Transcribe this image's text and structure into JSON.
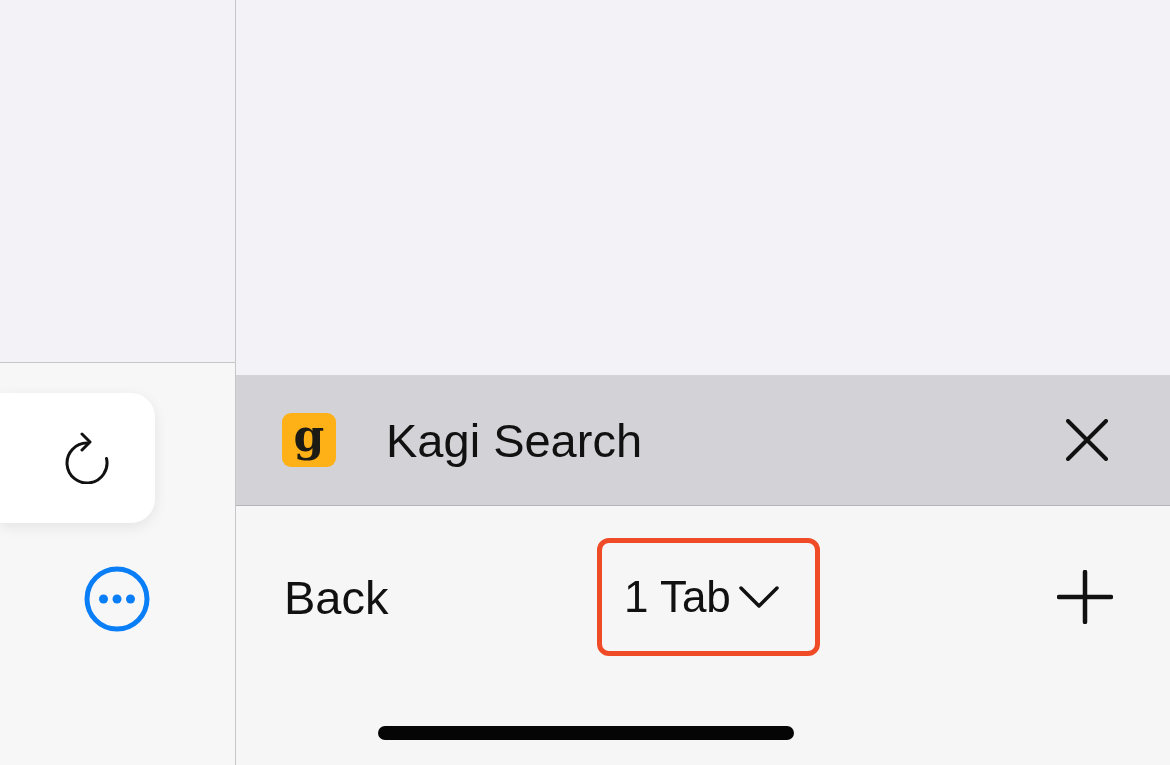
{
  "open_tab": {
    "favicon_letter": "g",
    "title": "Kagi Search"
  },
  "toolbar": {
    "back": "Back",
    "tab_count": {
      "label": "1 Tab",
      "highlighted": true
    }
  }
}
